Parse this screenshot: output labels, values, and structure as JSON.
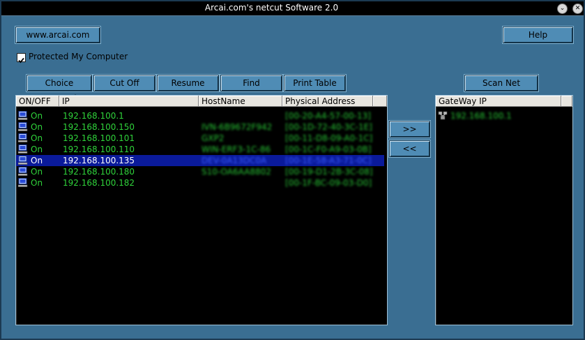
{
  "window": {
    "title": "Arcai.com's netcut Software 2.0"
  },
  "toolbar": {
    "website": "www.arcai.com",
    "help": "Help",
    "protect_label": "Protected My Computer",
    "choice_netcard": "Choice NetCard",
    "cut_off": "Cut Off",
    "resume": "Resume",
    "find": "Find",
    "print_table": "Print Table",
    "scan_net": "Scan Net",
    "add_gateway": ">>",
    "remove_gateway": "<<"
  },
  "hosts": {
    "columns": [
      "ON/OFF",
      "IP",
      "HostName",
      "Physical Address"
    ],
    "rows": [
      {
        "status": "On",
        "ip": "192.168.100.1",
        "hostname": "",
        "mac": "[00-20-A4-57-00-13]"
      },
      {
        "status": "On",
        "ip": "192.168.100.150",
        "hostname": "IVN-6B9672F942",
        "mac": "[00-1D-72-40-3C-1E]"
      },
      {
        "status": "On",
        "ip": "192.168.100.101",
        "hostname": "GXP2",
        "mac": "[00-11-D8-09-A0-1C]"
      },
      {
        "status": "On",
        "ip": "192.168.100.110",
        "hostname": "WIN-ERF3-1C-86",
        "mac": "[00-1C-F0-A9-03-0B]"
      },
      {
        "status": "On",
        "ip": "192.168.100.135",
        "hostname": "DEV-0A13DC0A",
        "mac": "[00-1E-58-A3-71-0C]"
      },
      {
        "status": "On",
        "ip": "192.168.100.180",
        "hostname": "S10-OA6AA8802",
        "mac": "[00-19-D1-2B-3C-08]"
      },
      {
        "status": "On",
        "ip": "192.168.100.182",
        "hostname": "",
        "mac": "[00-1F-BC-09-03-D0]"
      }
    ],
    "selected_index": 4
  },
  "gateway": {
    "column": "GateWay IP",
    "items": [
      {
        "ip": "192.168.100.1"
      }
    ]
  },
  "colors": {
    "frame": "#3a6e92",
    "list_text": "#2fd23a",
    "selection": "#0a1a9a"
  }
}
